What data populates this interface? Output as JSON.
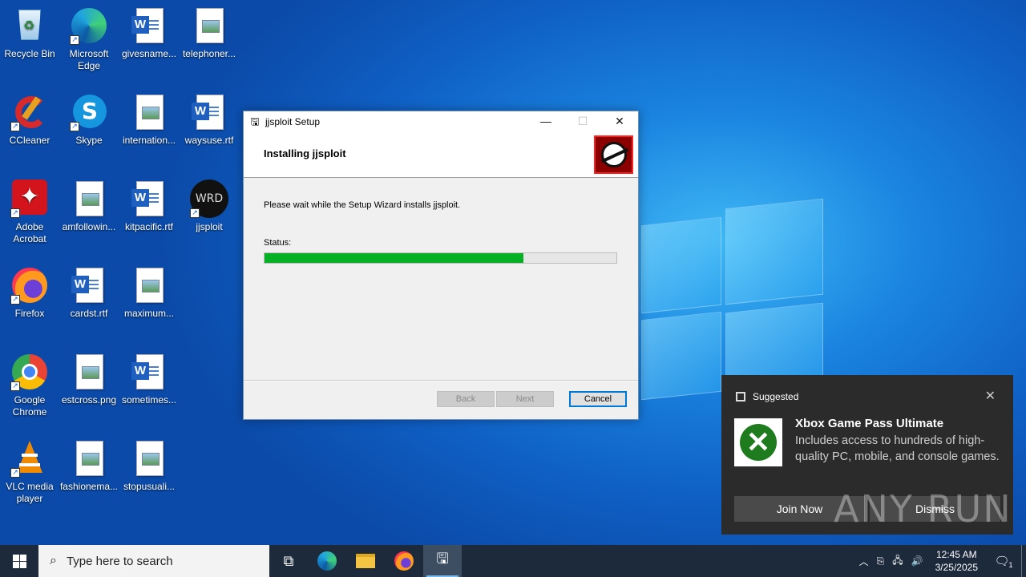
{
  "desktop": {
    "icons": [
      {
        "label": "Recycle Bin",
        "icon": "recycle-bin-icon"
      },
      {
        "label": "Microsoft Edge",
        "icon": "edge-icon"
      },
      {
        "label": "givesname...",
        "icon": "word-doc-icon"
      },
      {
        "label": "telephoner...",
        "icon": "image-file-icon"
      },
      {
        "label": "CCleaner",
        "icon": "ccleaner-icon"
      },
      {
        "label": "Skype",
        "icon": "skype-icon"
      },
      {
        "label": "internation...",
        "icon": "image-file-icon"
      },
      {
        "label": "waysuse.rtf",
        "icon": "word-doc-icon"
      },
      {
        "label": "Adobe Acrobat",
        "icon": "acrobat-icon"
      },
      {
        "label": "amfollowin...",
        "icon": "image-file-icon"
      },
      {
        "label": "kitpacific.rtf",
        "icon": "word-doc-icon"
      },
      {
        "label": "jjsploit",
        "icon": "jjsploit-icon"
      },
      {
        "label": "Firefox",
        "icon": "firefox-icon"
      },
      {
        "label": "cardst.rtf",
        "icon": "word-doc-icon"
      },
      {
        "label": "maximum...",
        "icon": "image-file-icon"
      },
      {
        "label": "Google Chrome",
        "icon": "chrome-icon"
      },
      {
        "label": "estcross.png",
        "icon": "image-file-icon"
      },
      {
        "label": "sometimes...",
        "icon": "word-doc-icon"
      },
      {
        "label": "VLC media player",
        "icon": "vlc-icon"
      },
      {
        "label": "fashionema...",
        "icon": "image-file-icon"
      },
      {
        "label": "stopusuali...",
        "icon": "image-file-icon"
      }
    ]
  },
  "dialog": {
    "title": "jjsploit Setup",
    "heading": "Installing jjsploit",
    "message": "Please wait while the Setup Wizard installs jjsploit.",
    "status_label": "Status:",
    "progress_fraction": 0.735,
    "buttons": {
      "back": "Back",
      "next": "Next",
      "cancel": "Cancel"
    },
    "progress_color": "#06b025"
  },
  "notification": {
    "header": "Suggested",
    "title": "Xbox Game Pass Ultimate",
    "description": "Includes access to hundreds of high-quality PC, mobile, and console games.",
    "join_label": "Join Now",
    "dismiss_label": "Dismiss"
  },
  "watermark": "ANY RUN",
  "taskbar": {
    "search_placeholder": "Type here to search",
    "time": "12:45 AM",
    "date": "3/25/2025",
    "notification_count": "1"
  }
}
